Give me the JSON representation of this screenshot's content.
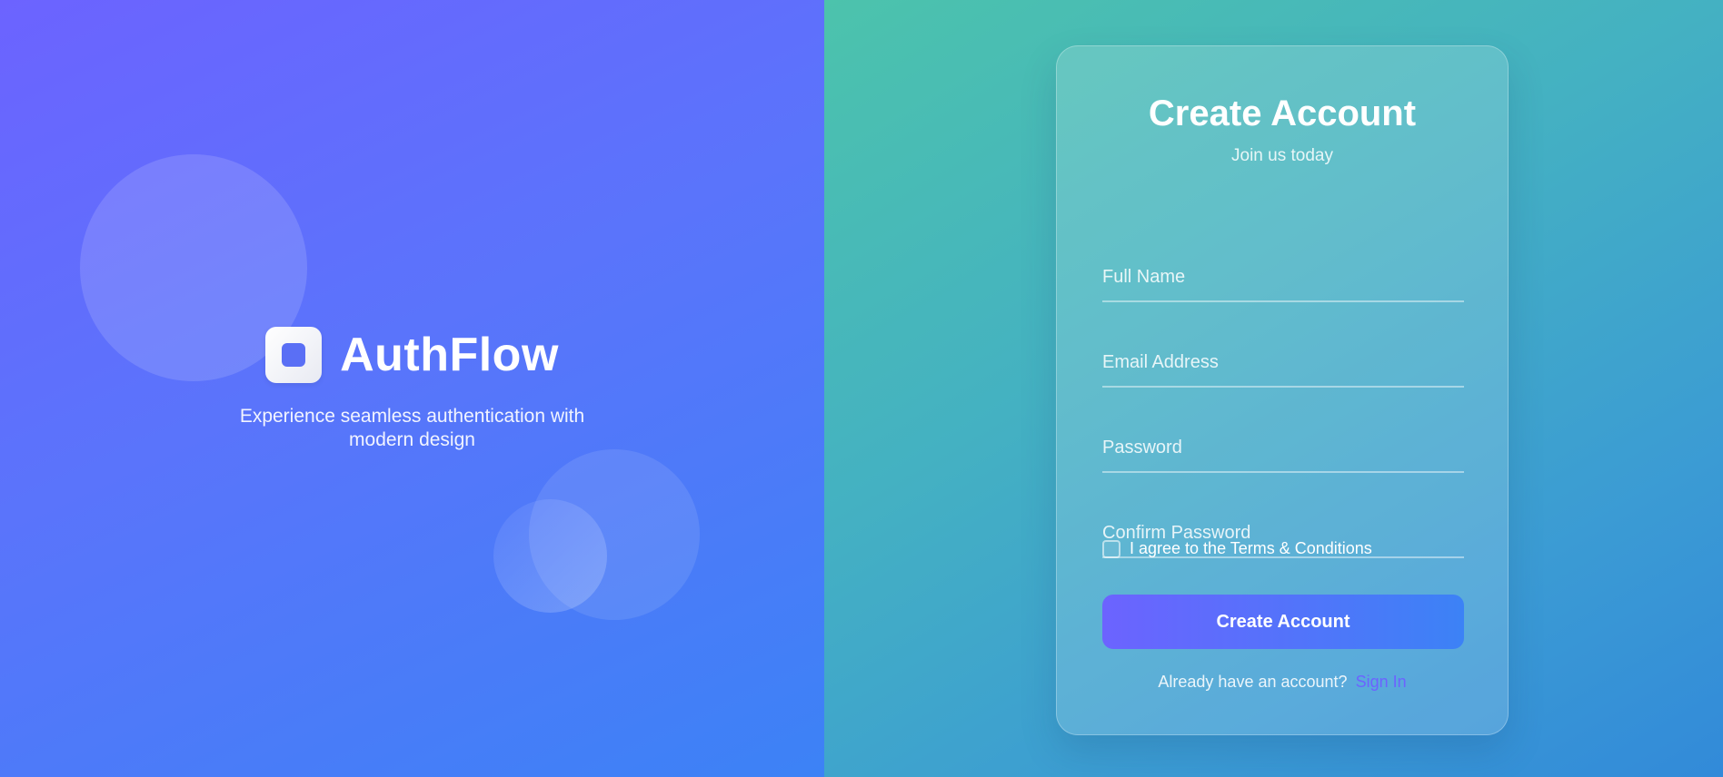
{
  "brand": {
    "name": "AuthFlow",
    "tagline": "Experience seamless authentication with modern design"
  },
  "form": {
    "title": "Create Account",
    "subtitle": "Join us today",
    "fields": {
      "full_name": {
        "placeholder": "Full Name",
        "value": ""
      },
      "email": {
        "placeholder": "Email Address",
        "value": ""
      },
      "password": {
        "placeholder": "Password",
        "value": ""
      },
      "confirm_password": {
        "placeholder": "Confirm Password",
        "value": ""
      }
    },
    "terms_label": "I agree to the Terms & Conditions",
    "terms_checked": false,
    "submit_label": "Create Account",
    "signin_prompt": "Already have an account?",
    "signin_link": "Sign In"
  },
  "colors": {
    "brand_gradient_start": "#6c63ff",
    "brand_gradient_end": "#3c82f6",
    "form_gradient_start": "#4cc3ac",
    "form_gradient_end": "#328ad9",
    "link": "#6c63ff"
  },
  "icons": {
    "logo": "square-logo-icon"
  }
}
